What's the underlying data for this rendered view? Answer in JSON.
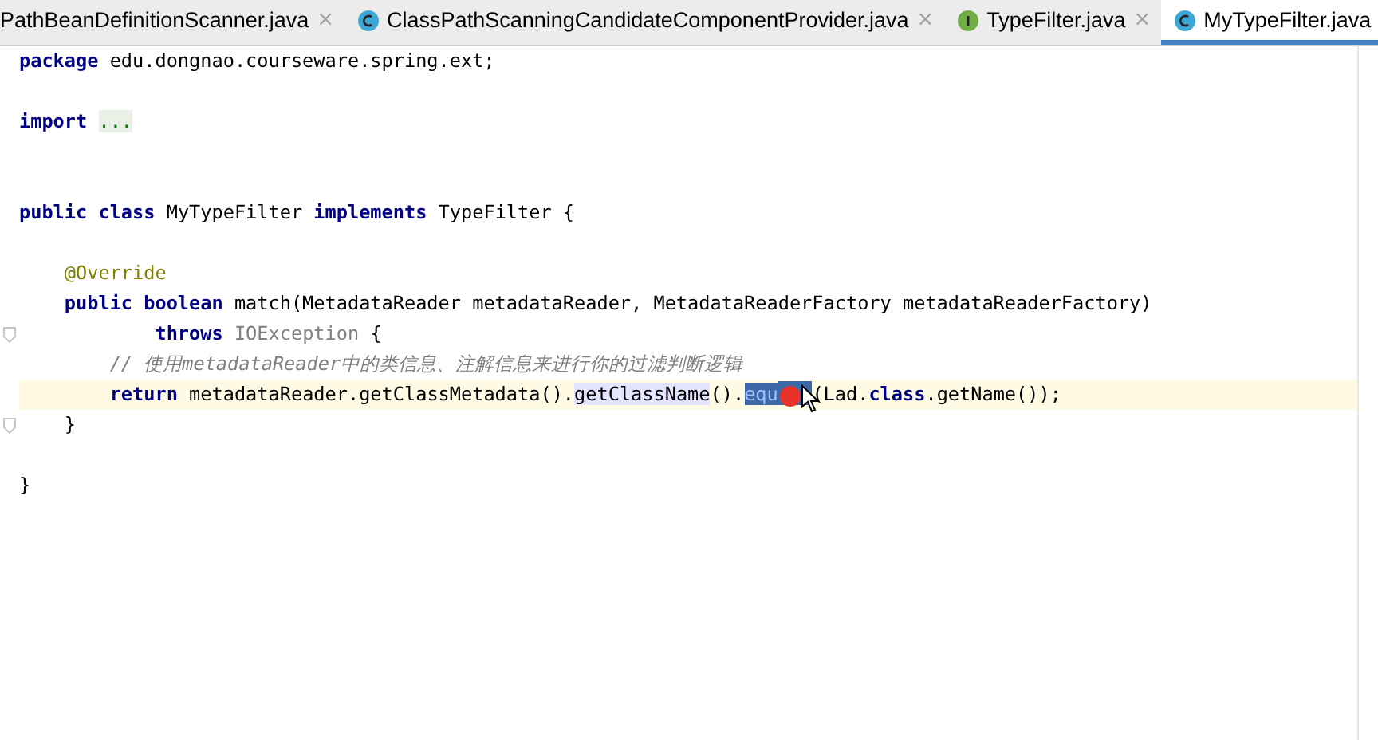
{
  "tabs": [
    {
      "label": "PathBeanDefinitionScanner.java",
      "kind": "plain",
      "selected": false,
      "close": "×"
    },
    {
      "label": "ClassPathScanningCandidateComponentProvider.java",
      "kind": "class",
      "selected": false,
      "close": "×"
    },
    {
      "label": "TypeFilter.java",
      "kind": "interface",
      "selected": false,
      "close": "×"
    },
    {
      "label": "MyTypeFilter.java",
      "kind": "class",
      "selected": true
    }
  ],
  "lines": [
    {
      "kind": "code",
      "tokens": [
        {
          "text": "package",
          "kind": "keyword"
        },
        {
          "text": " edu.dongnao.courseware.spring.ext;",
          "kind": "plain"
        }
      ]
    },
    {
      "kind": "blank"
    },
    {
      "kind": "code",
      "tokens": [
        {
          "text": "import ",
          "kind": "keyword"
        },
        {
          "text": "...",
          "kind": "folded"
        }
      ]
    },
    {
      "kind": "blank"
    },
    {
      "kind": "blank"
    },
    {
      "kind": "code",
      "tokens": [
        {
          "text": "public class",
          "kind": "keyword"
        },
        {
          "text": " MyTypeFilter ",
          "kind": "plain"
        },
        {
          "text": "implements",
          "kind": "keyword"
        },
        {
          "text": " TypeFilter {",
          "kind": "plain"
        }
      ]
    },
    {
      "kind": "blank"
    },
    {
      "kind": "code",
      "tokens": [
        {
          "text": "    @Override",
          "kind": "annotation"
        }
      ]
    },
    {
      "kind": "code",
      "tokens": [
        {
          "text": "    public boolean",
          "kind": "keyword"
        },
        {
          "text": " match(MetadataReader metadataReader, MetadataReaderFactory metadataReaderFactory)",
          "kind": "plain"
        }
      ]
    },
    {
      "kind": "code",
      "fold": true,
      "tokens": [
        {
          "text": "            throws ",
          "kind": "keyword"
        },
        {
          "text": "IOException",
          "kind": "unused"
        },
        {
          "text": " {",
          "kind": "plain"
        }
      ]
    },
    {
      "kind": "code",
      "tokens": [
        {
          "text": "        // 使用metadataReader中的类信息、注解信息来进行你的过滤判断逻辑",
          "kind": "comment"
        }
      ]
    },
    {
      "kind": "code",
      "caret_row": true,
      "tokens": [
        {
          "text": "        return",
          "kind": "keyword"
        },
        {
          "text": " metadataReader.getClassMetadata().",
          "kind": "plain"
        },
        {
          "text": "getClassName",
          "kind": "usage"
        },
        {
          "text": "().",
          "kind": "plain"
        },
        {
          "text": "equ",
          "kind": "selected",
          "click_marker": true
        },
        {
          "text": "(Lad.",
          "kind": "plain"
        },
        {
          "text": "class",
          "kind": "keyword"
        },
        {
          "text": ".getName());",
          "kind": "plain"
        }
      ]
    },
    {
      "kind": "code",
      "fold": true,
      "tokens": [
        {
          "text": "    }",
          "kind": "plain"
        }
      ]
    },
    {
      "kind": "blank"
    },
    {
      "kind": "code",
      "tokens": [
        {
          "text": "}",
          "kind": "plain"
        }
      ]
    }
  ]
}
